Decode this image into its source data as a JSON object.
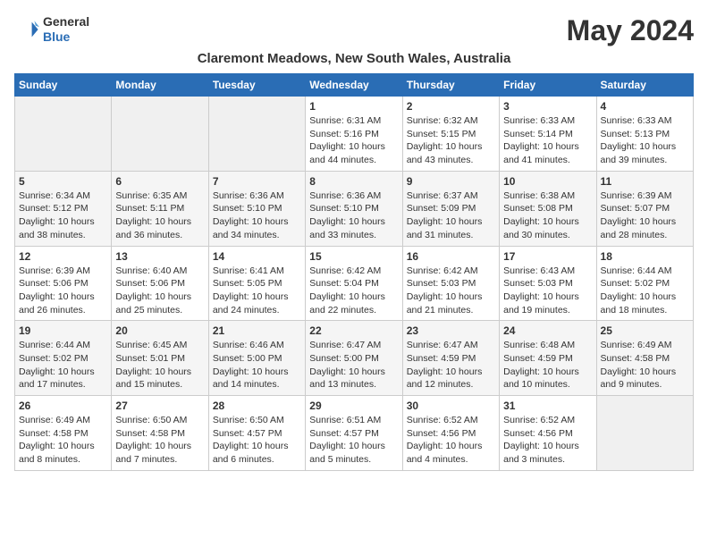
{
  "logo": {
    "line1": "General",
    "line2": "Blue"
  },
  "title": "May 2024",
  "subtitle": "Claremont Meadows, New South Wales, Australia",
  "weekdays": [
    "Sunday",
    "Monday",
    "Tuesday",
    "Wednesday",
    "Thursday",
    "Friday",
    "Saturday"
  ],
  "weeks": [
    [
      {
        "num": "",
        "info": ""
      },
      {
        "num": "",
        "info": ""
      },
      {
        "num": "",
        "info": ""
      },
      {
        "num": "1",
        "info": "Sunrise: 6:31 AM\nSunset: 5:16 PM\nDaylight: 10 hours\nand 44 minutes."
      },
      {
        "num": "2",
        "info": "Sunrise: 6:32 AM\nSunset: 5:15 PM\nDaylight: 10 hours\nand 43 minutes."
      },
      {
        "num": "3",
        "info": "Sunrise: 6:33 AM\nSunset: 5:14 PM\nDaylight: 10 hours\nand 41 minutes."
      },
      {
        "num": "4",
        "info": "Sunrise: 6:33 AM\nSunset: 5:13 PM\nDaylight: 10 hours\nand 39 minutes."
      }
    ],
    [
      {
        "num": "5",
        "info": "Sunrise: 6:34 AM\nSunset: 5:12 PM\nDaylight: 10 hours\nand 38 minutes."
      },
      {
        "num": "6",
        "info": "Sunrise: 6:35 AM\nSunset: 5:11 PM\nDaylight: 10 hours\nand 36 minutes."
      },
      {
        "num": "7",
        "info": "Sunrise: 6:36 AM\nSunset: 5:10 PM\nDaylight: 10 hours\nand 34 minutes."
      },
      {
        "num": "8",
        "info": "Sunrise: 6:36 AM\nSunset: 5:10 PM\nDaylight: 10 hours\nand 33 minutes."
      },
      {
        "num": "9",
        "info": "Sunrise: 6:37 AM\nSunset: 5:09 PM\nDaylight: 10 hours\nand 31 minutes."
      },
      {
        "num": "10",
        "info": "Sunrise: 6:38 AM\nSunset: 5:08 PM\nDaylight: 10 hours\nand 30 minutes."
      },
      {
        "num": "11",
        "info": "Sunrise: 6:39 AM\nSunset: 5:07 PM\nDaylight: 10 hours\nand 28 minutes."
      }
    ],
    [
      {
        "num": "12",
        "info": "Sunrise: 6:39 AM\nSunset: 5:06 PM\nDaylight: 10 hours\nand 26 minutes."
      },
      {
        "num": "13",
        "info": "Sunrise: 6:40 AM\nSunset: 5:06 PM\nDaylight: 10 hours\nand 25 minutes."
      },
      {
        "num": "14",
        "info": "Sunrise: 6:41 AM\nSunset: 5:05 PM\nDaylight: 10 hours\nand 24 minutes."
      },
      {
        "num": "15",
        "info": "Sunrise: 6:42 AM\nSunset: 5:04 PM\nDaylight: 10 hours\nand 22 minutes."
      },
      {
        "num": "16",
        "info": "Sunrise: 6:42 AM\nSunset: 5:03 PM\nDaylight: 10 hours\nand 21 minutes."
      },
      {
        "num": "17",
        "info": "Sunrise: 6:43 AM\nSunset: 5:03 PM\nDaylight: 10 hours\nand 19 minutes."
      },
      {
        "num": "18",
        "info": "Sunrise: 6:44 AM\nSunset: 5:02 PM\nDaylight: 10 hours\nand 18 minutes."
      }
    ],
    [
      {
        "num": "19",
        "info": "Sunrise: 6:44 AM\nSunset: 5:02 PM\nDaylight: 10 hours\nand 17 minutes."
      },
      {
        "num": "20",
        "info": "Sunrise: 6:45 AM\nSunset: 5:01 PM\nDaylight: 10 hours\nand 15 minutes."
      },
      {
        "num": "21",
        "info": "Sunrise: 6:46 AM\nSunset: 5:00 PM\nDaylight: 10 hours\nand 14 minutes."
      },
      {
        "num": "22",
        "info": "Sunrise: 6:47 AM\nSunset: 5:00 PM\nDaylight: 10 hours\nand 13 minutes."
      },
      {
        "num": "23",
        "info": "Sunrise: 6:47 AM\nSunset: 4:59 PM\nDaylight: 10 hours\nand 12 minutes."
      },
      {
        "num": "24",
        "info": "Sunrise: 6:48 AM\nSunset: 4:59 PM\nDaylight: 10 hours\nand 10 minutes."
      },
      {
        "num": "25",
        "info": "Sunrise: 6:49 AM\nSunset: 4:58 PM\nDaylight: 10 hours\nand 9 minutes."
      }
    ],
    [
      {
        "num": "26",
        "info": "Sunrise: 6:49 AM\nSunset: 4:58 PM\nDaylight: 10 hours\nand 8 minutes."
      },
      {
        "num": "27",
        "info": "Sunrise: 6:50 AM\nSunset: 4:58 PM\nDaylight: 10 hours\nand 7 minutes."
      },
      {
        "num": "28",
        "info": "Sunrise: 6:50 AM\nSunset: 4:57 PM\nDaylight: 10 hours\nand 6 minutes."
      },
      {
        "num": "29",
        "info": "Sunrise: 6:51 AM\nSunset: 4:57 PM\nDaylight: 10 hours\nand 5 minutes."
      },
      {
        "num": "30",
        "info": "Sunrise: 6:52 AM\nSunset: 4:56 PM\nDaylight: 10 hours\nand 4 minutes."
      },
      {
        "num": "31",
        "info": "Sunrise: 6:52 AM\nSunset: 4:56 PM\nDaylight: 10 hours\nand 3 minutes."
      },
      {
        "num": "",
        "info": ""
      }
    ]
  ]
}
